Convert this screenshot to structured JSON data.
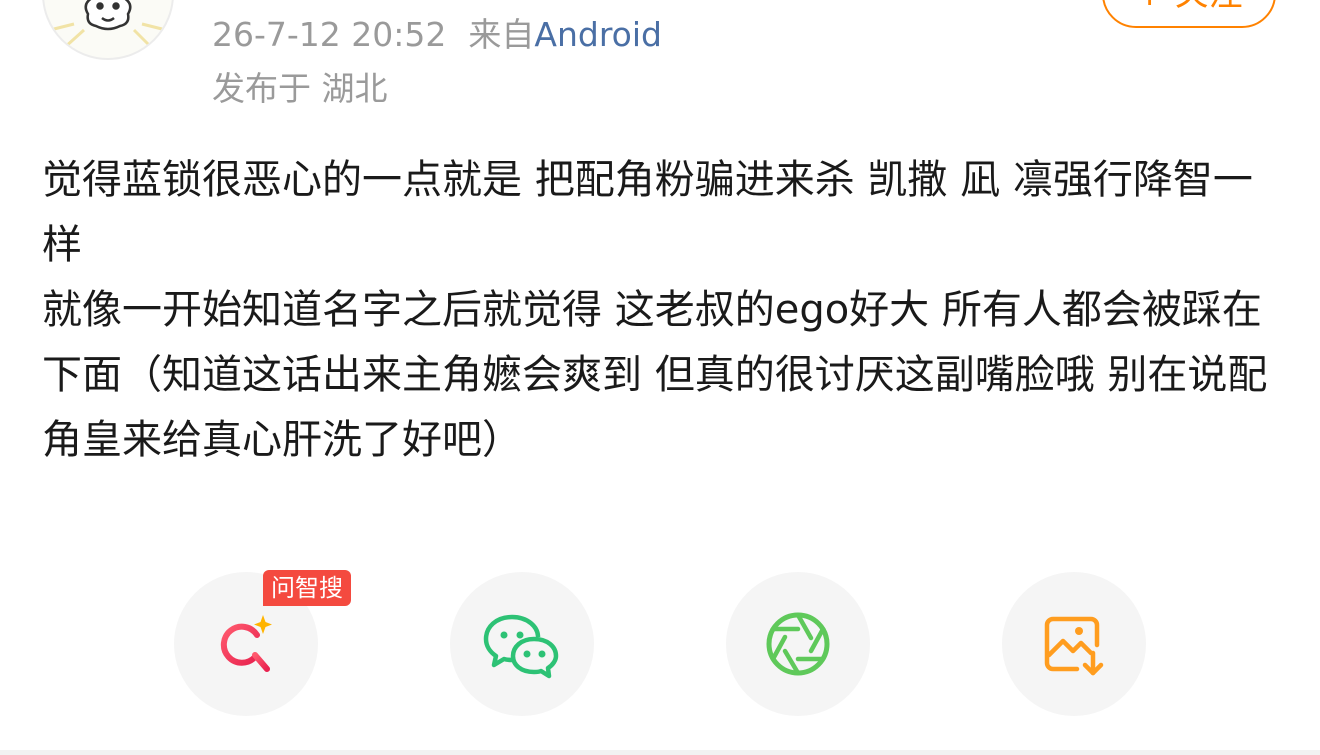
{
  "header": {
    "follow_label": "+ 关注",
    "timestamp": "26-7-12 20:52",
    "source_prefix": "来自",
    "source_name": "Android",
    "location": "发布于 湖北"
  },
  "post": {
    "paragraphs": [
      "觉得蓝锁很恶心的一点就是 把配角粉骗进来杀 凯撒 凪 凛强行降智一样",
      "就像一开始知道名字之后就觉得 这老叔的ego好大 所有人都会被踩在下面（知道这话出来主角嬷会爽到 但真的很讨厌这副嘴脸哦 别在说配角皇来给真心肝洗了好吧）"
    ]
  },
  "share": {
    "ai_badge": "问智搜",
    "items": [
      {
        "icon": "ai-search-icon",
        "color": "#f0394f"
      },
      {
        "icon": "wechat-icon",
        "color": "#2dc275"
      },
      {
        "icon": "moments-icon",
        "color": "#5fc95a"
      },
      {
        "icon": "save-image-icon",
        "color": "#ff9d1f"
      }
    ]
  },
  "colors": {
    "accent": "#ff8200",
    "meta_text": "#9a9a9a",
    "source_link": "#4a6fa5",
    "body_text": "#1a1a1a",
    "badge": "#f44a3f"
  }
}
